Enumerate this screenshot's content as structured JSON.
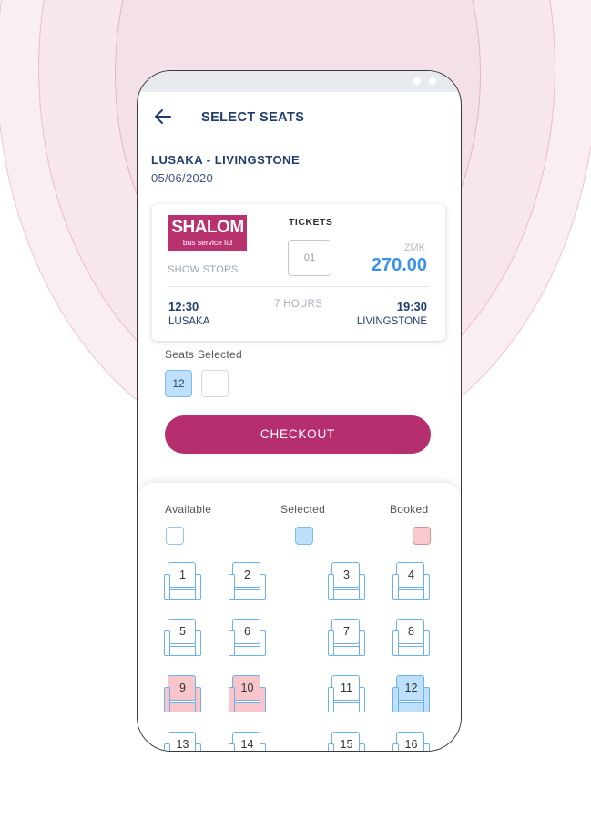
{
  "header": {
    "title": "SELECT SEATS"
  },
  "trip": {
    "route": "LUSAKA - LIVINGSTONE",
    "date": "05/06/2020"
  },
  "card": {
    "operator_logo_text": "SHALOM",
    "operator_logo_subtitle": "bus service ltd",
    "show_stops_label": "SHOW STOPS",
    "tickets_label": "TICKETS",
    "ticket_count": "01",
    "currency": "ZMK",
    "price": "270.00",
    "departure_time": "12:30",
    "departure_city": "LUSAKA",
    "duration": "7 HOURS",
    "arrival_time": "19:30",
    "arrival_city": "LIVINGSTONE"
  },
  "selection": {
    "label": "Seats Selected",
    "seats": [
      "12",
      ""
    ]
  },
  "checkout_label": "CHECKOUT",
  "legend": {
    "available": "Available",
    "selected": "Selected",
    "booked": "Booked"
  },
  "seats": [
    {
      "num": "1",
      "state": "available"
    },
    {
      "num": "2",
      "state": "available"
    },
    {
      "num": "3",
      "state": "available"
    },
    {
      "num": "4",
      "state": "available"
    },
    {
      "num": "5",
      "state": "available"
    },
    {
      "num": "6",
      "state": "available"
    },
    {
      "num": "7",
      "state": "available"
    },
    {
      "num": "8",
      "state": "available"
    },
    {
      "num": "9",
      "state": "booked"
    },
    {
      "num": "10",
      "state": "booked"
    },
    {
      "num": "11",
      "state": "available"
    },
    {
      "num": "12",
      "state": "selected"
    },
    {
      "num": "13",
      "state": "available"
    },
    {
      "num": "14",
      "state": "available"
    },
    {
      "num": "15",
      "state": "available"
    },
    {
      "num": "16",
      "state": "available"
    }
  ],
  "colors": {
    "accent": "#b52e6d",
    "navy": "#1f3d6e",
    "price_blue": "#3c92e6",
    "seat_outline": "#6cb1ea",
    "selected_fill": "#bfe0fb",
    "booked_fill": "#f7c5cb"
  },
  "icons": {
    "back": "arrow-left-icon"
  }
}
